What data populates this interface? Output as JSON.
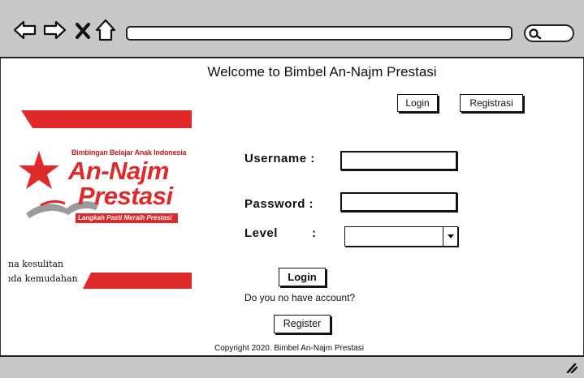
{
  "page": {
    "title": "Welcome to Bimbel An-Najm Prestasi",
    "copyright": "Copyright 2020. Bimbel An-Najm Prestasi"
  },
  "header_nav": {
    "login_label": "Login",
    "register_label": "Registrasi"
  },
  "logo": {
    "tagline_top": "Bimbingan Belajar Anak Indonesia",
    "name_line1": "An-Najm",
    "name_line2": "Prestasi",
    "slogan": "Langkah Pasti Meraih Prestasi",
    "side_line1": "na kesulitan",
    "side_line2": "ıda kemudahan",
    "brand_color": "#e02a2a"
  },
  "form": {
    "username_label": "Username :",
    "username_value": "",
    "password_label": "Password :",
    "password_value": "",
    "level_label": "Level",
    "level_colon": ":",
    "level_selected": "",
    "login_button": "Login",
    "no_account_text": "Do you no have account?",
    "register_button": "Register"
  },
  "icons": {
    "back": "arrow-left-icon",
    "forward": "arrow-right-icon",
    "close": "close-icon",
    "home": "home-icon",
    "search": "search-icon",
    "resize": "resize-grip-icon"
  }
}
